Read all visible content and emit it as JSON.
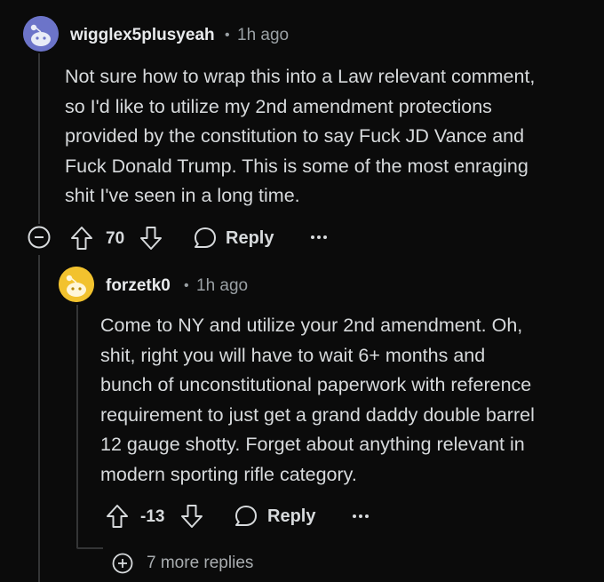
{
  "comment1": {
    "username": "wigglex5plusyeah",
    "separator": "•",
    "time": "1h ago",
    "lines": [
      "Not sure how to wrap this into a Law relevant comment,",
      "so I'd like to utilize my 2nd amendment protections",
      "provided by the constitution to say Fuck JD Vance and",
      "Fuck Donald Trump. This is some of the most enraging",
      "shit I've seen in a long time."
    ],
    "score": "70",
    "reply_label": "Reply",
    "avatar_color": "#6c74c9"
  },
  "comment2": {
    "username": "forzetk0",
    "separator": "•",
    "time": "1h ago",
    "lines": [
      "Come to NY and utilize your 2nd amendment. Oh,",
      "shit, right you will have to wait 6+ months and",
      "bunch of unconstitutional paperwork with reference",
      "requirement to just get a grand daddy double barrel",
      "12 gauge shotty. Forget about anything relevant in",
      "modern sporting rifle category."
    ],
    "score": "-13",
    "reply_label": "Reply",
    "avatar_color": "#f2c22e"
  },
  "more_replies": "7 more replies",
  "icons": {
    "collapse": "minus-circle-icon",
    "upvote": "arrow-up-icon",
    "downvote": "arrow-down-icon",
    "reply": "speech-bubble-icon",
    "overflow": "ellipsis-icon",
    "expand": "plus-circle-icon"
  }
}
